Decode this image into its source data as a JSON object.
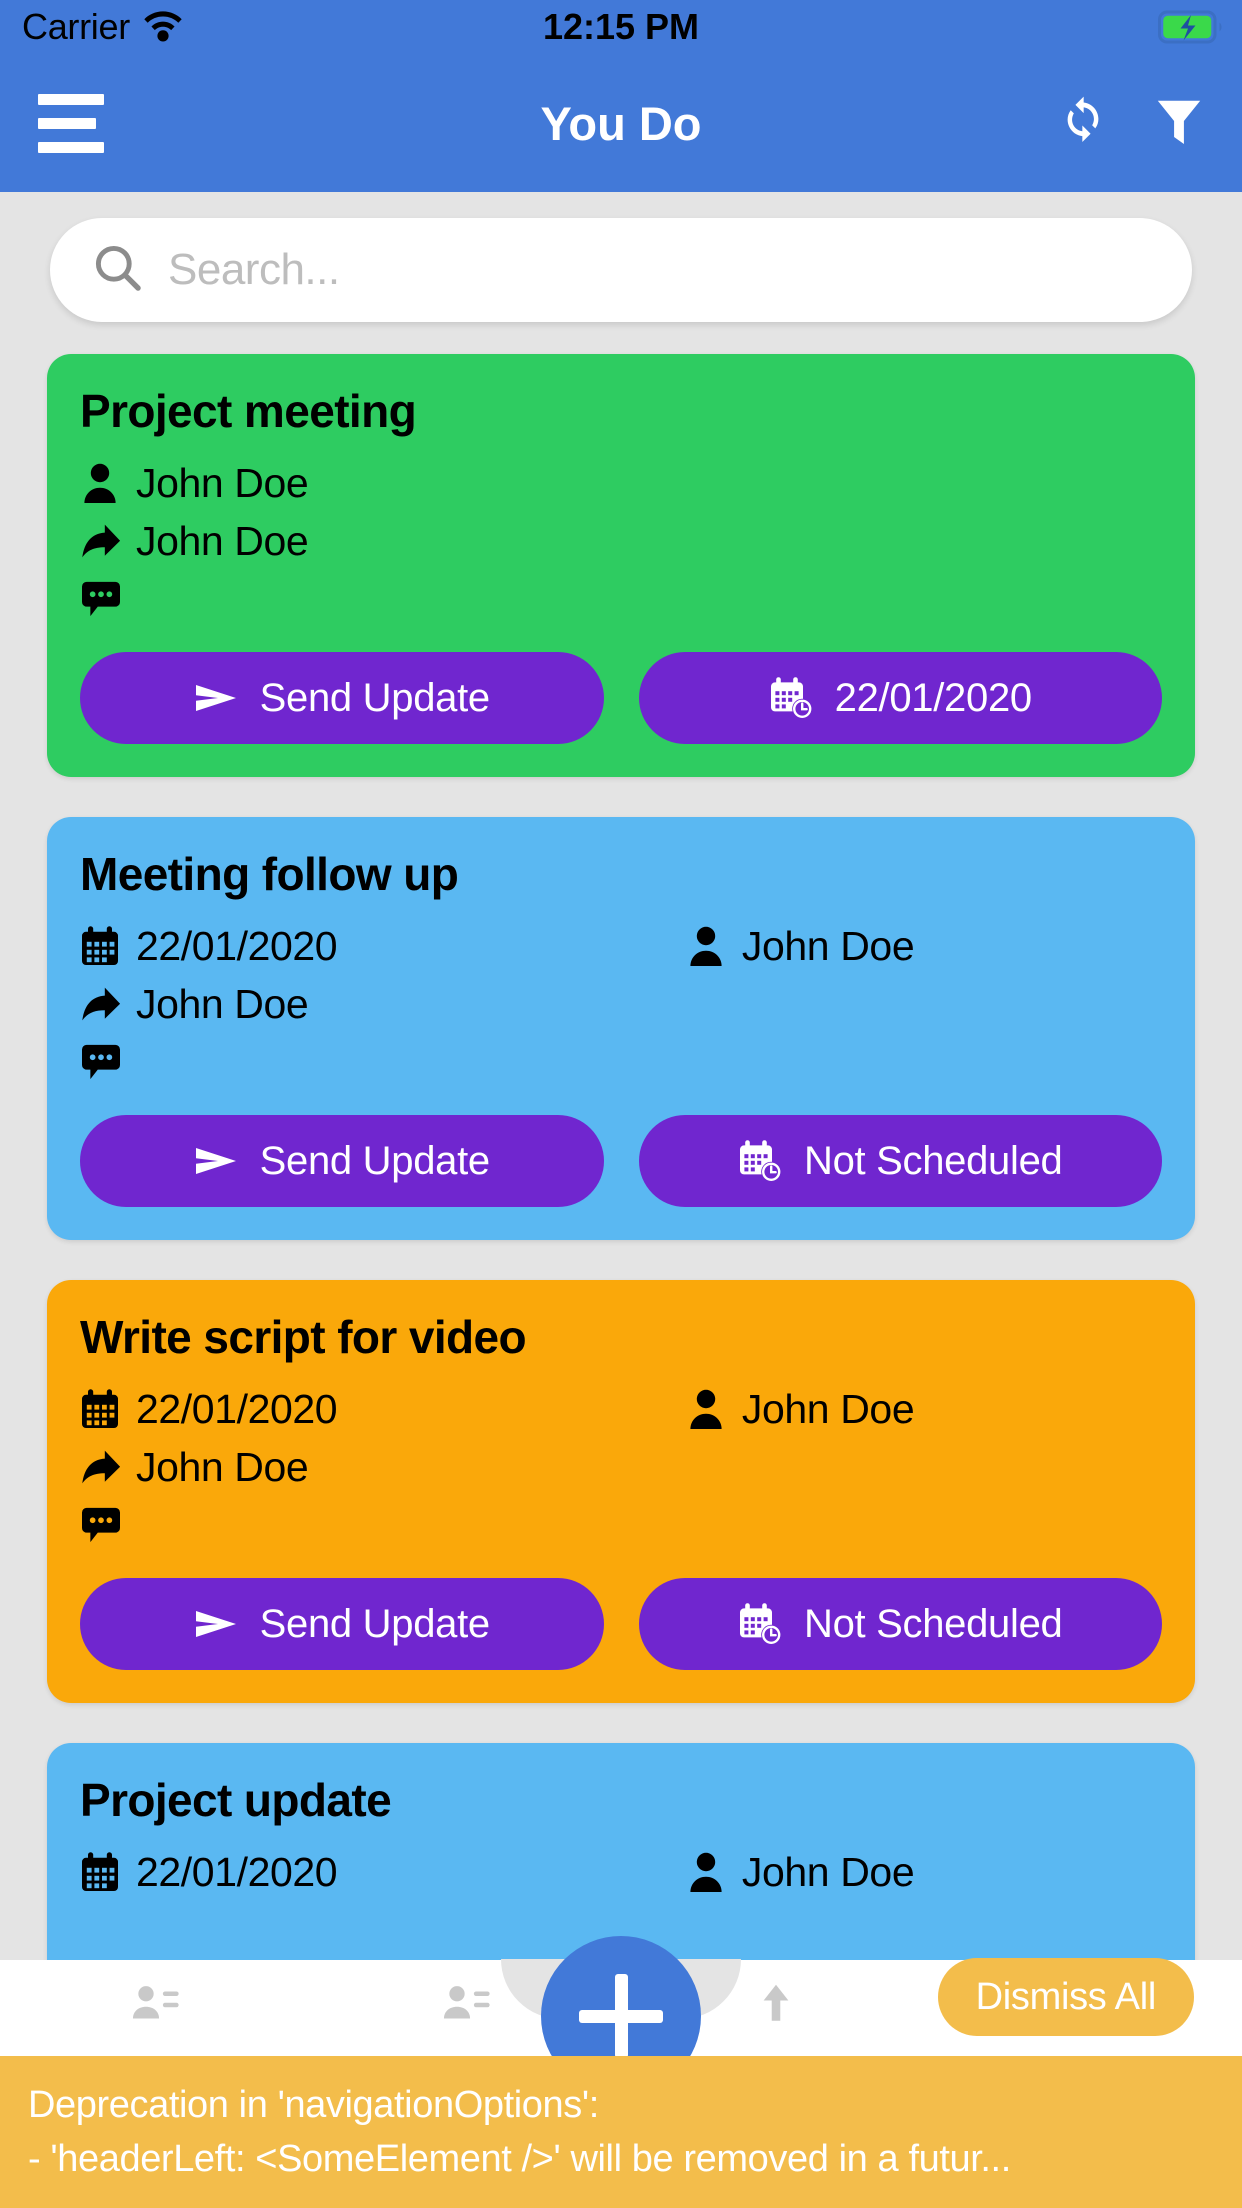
{
  "statusbar": {
    "carrier": "Carrier",
    "time": "12:15 PM",
    "wifi_icon": "wifi-icon",
    "battery_icon": "battery-charging-icon"
  },
  "navbar": {
    "title": "You Do",
    "menu_icon": "hamburger-menu-icon",
    "sync_icon": "sync-refresh-icon",
    "filter_icon": "filter-funnel-icon"
  },
  "search": {
    "placeholder": "Search...",
    "value": "",
    "icon": "search-icon"
  },
  "colors": {
    "nav_blue": "#4279d8",
    "card_green": "#2ecc61",
    "card_blue": "#5ab8f2",
    "card_orange": "#faa80a",
    "button_purple": "#7026cf",
    "accent_amber": "#f3bd4b",
    "page_bg": "#e4e4e4"
  },
  "cards": [
    {
      "title": "Project meeting",
      "color": "#2ecc61",
      "rows": [
        {
          "type": "single",
          "left_icon": "person-icon",
          "left_text": "John Doe"
        },
        {
          "type": "single",
          "left_icon": "share-forward-icon",
          "left_text": "John Doe"
        },
        {
          "type": "icon-only",
          "left_icon": "comment-bubble-icon",
          "left_text": ""
        }
      ],
      "buttons": [
        {
          "icon": "send-paper-plane-icon",
          "label": "Send Update"
        },
        {
          "icon": "calendar-clock-icon",
          "label": "22/01/2020"
        }
      ]
    },
    {
      "title": "Meeting follow up",
      "color": "#5ab8f2",
      "rows": [
        {
          "type": "split",
          "left_icon": "calendar-icon",
          "left_text": "22/01/2020",
          "right_icon": "person-icon",
          "right_text": "John Doe"
        },
        {
          "type": "single",
          "left_icon": "share-forward-icon",
          "left_text": "John Doe"
        },
        {
          "type": "icon-only",
          "left_icon": "comment-bubble-icon",
          "left_text": ""
        }
      ],
      "buttons": [
        {
          "icon": "send-paper-plane-icon",
          "label": "Send Update"
        },
        {
          "icon": "calendar-clock-icon",
          "label": "Not Scheduled"
        }
      ]
    },
    {
      "title": "Write script for video",
      "color": "#faa80a",
      "rows": [
        {
          "type": "split",
          "left_icon": "calendar-icon",
          "left_text": "22/01/2020",
          "right_icon": "person-icon",
          "right_text": "John Doe"
        },
        {
          "type": "single",
          "left_icon": "share-forward-icon",
          "left_text": "John Doe"
        },
        {
          "type": "icon-only",
          "left_icon": "comment-bubble-icon",
          "left_text": ""
        }
      ],
      "buttons": [
        {
          "icon": "send-paper-plane-icon",
          "label": "Send Update"
        },
        {
          "icon": "calendar-clock-icon",
          "label": "Not Scheduled"
        }
      ]
    },
    {
      "title": "Project update",
      "color": "#5ab8f2",
      "rows": [
        {
          "type": "split",
          "left_icon": "calendar-icon",
          "left_text": "22/01/2020",
          "right_icon": "person-icon",
          "right_text": "John Doe"
        }
      ],
      "buttons": []
    }
  ],
  "fab": {
    "icon": "plus-icon"
  },
  "dismiss_all": {
    "label": "Dismiss All"
  },
  "tabs": [
    {
      "icon": "people-list-icon",
      "label": ""
    },
    {
      "icon": "people-list-icon",
      "label": ""
    },
    {
      "icon": "arrow-up-icon",
      "label": ""
    },
    {
      "icon": "calendar-icon",
      "label": ""
    }
  ],
  "warning": {
    "line1": "Deprecation in 'navigationOptions':",
    "line2": "- 'headerLeft: <SomeElement />' will be removed in a futur..."
  }
}
